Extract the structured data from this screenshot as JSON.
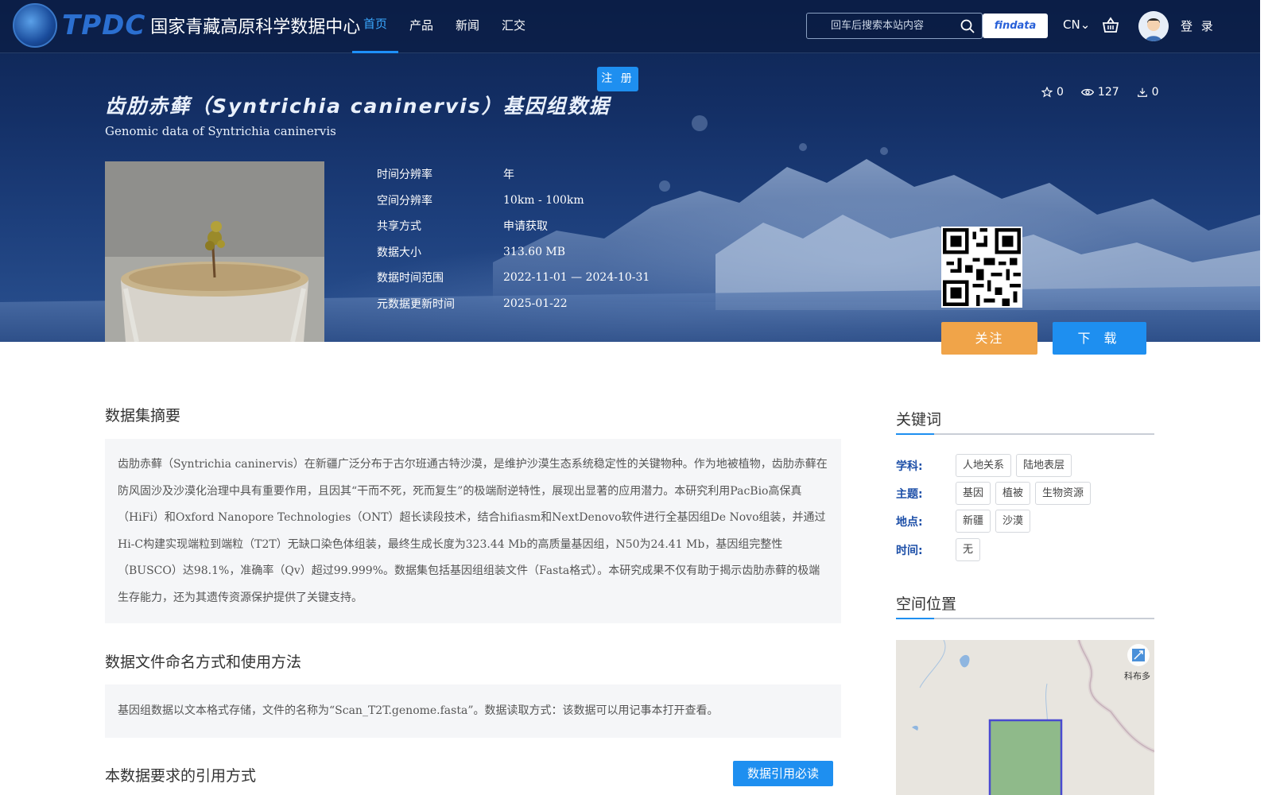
{
  "header": {
    "logo_text_en": "TPDC",
    "logo_text_cn": "国家青藏高原科学数据中心",
    "nav": [
      {
        "label": "首页",
        "active": true
      },
      {
        "label": "产品",
        "active": false
      },
      {
        "label": "新闻",
        "active": false
      },
      {
        "label": "汇交",
        "active": false
      }
    ],
    "search_placeholder": "回车后搜索本站内容",
    "findata_label": "findata",
    "lang_label": "CN",
    "login_label": "登 录",
    "register_label": "注 册"
  },
  "dataset": {
    "title": "齿肋赤藓（Syntrichia caninervis）基因组数据",
    "subtitle": "Genomic data of Syntrichia caninervis",
    "stats": {
      "stars": "0",
      "views": "127",
      "downloads": "0"
    },
    "meta": [
      {
        "label": "时间分辨率",
        "value": "年"
      },
      {
        "label": "空间分辨率",
        "value": "10km - 100km"
      },
      {
        "label": "共享方式",
        "value": "申请获取"
      },
      {
        "label": "数据大小",
        "value": "313.60 MB"
      },
      {
        "label": "数据时间范围",
        "value": "2022-11-01 — 2024-10-31"
      },
      {
        "label": "元数据更新时间",
        "value": "2025-01-22"
      }
    ],
    "follow_label": "关注",
    "download_label": "下 载"
  },
  "content": {
    "abstract_heading": "数据集摘要",
    "abstract_text": "齿肋赤藓（Syntrichia caninervis）在新疆广泛分布于古尔班通古特沙漠，是维护沙漠生态系统稳定性的关键物种。作为地被植物，齿肋赤藓在防风固沙及沙漠化治理中具有重要作用，且因其“干而不死，死而复生”的极端耐逆特性，展现出显著的应用潜力。本研究利用PacBio高保真（HiFi）和Oxford Nanopore Technologies（ONT）超长读段技术，结合hifiasm和NextDenovo软件进行全基因组De Novo组装，并通过Hi-C构建实现端粒到端粒（T2T）无缺口染色体组装，最终生成长度为323.44 Mb的高质量基因组，N50为24.41 Mb，基因组完整性（BUSCO）达98.1%，准确率（Qv）超过99.999%。数据集包括基因组组装文件（Fasta格式）。本研究成果不仅有助于揭示齿肋赤藓的极端生存能力，还为其遗传资源保护提供了关键支持。",
    "file_heading": "数据文件命名方式和使用方法",
    "file_text": "基因组数据以文本格式存储，文件的名称为“Scan_T2T.genome.fasta”。数据读取方式：该数据可以用记事本打开查看。",
    "cite_heading": "本数据要求的引用方式",
    "cite_button": "数据引用必读"
  },
  "sidebar": {
    "keywords_heading": "关键词",
    "keyword_groups": [
      {
        "label": "学科:",
        "tags": [
          "人地关系",
          "陆地表层"
        ]
      },
      {
        "label": "主题:",
        "tags": [
          "基因",
          "植被",
          "生物资源"
        ]
      },
      {
        "label": "地点:",
        "tags": [
          "新疆",
          "沙漠"
        ]
      },
      {
        "label": "时间:",
        "tags": [
          "无"
        ]
      }
    ],
    "location_heading": "空间位置",
    "map_label": "科布多"
  }
}
